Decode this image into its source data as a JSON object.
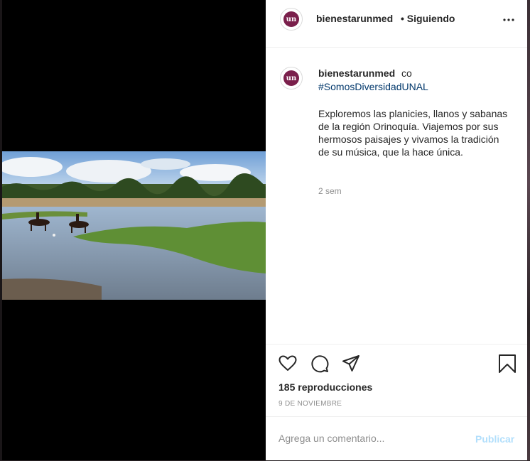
{
  "header": {
    "username": "bienestarunmed",
    "separator": "•",
    "following": "Siguiendo",
    "avatar_text": "un"
  },
  "caption": {
    "username": "bienestarunmed",
    "coauthor_prefix": "co",
    "hashtag": "#SomosDiversidadUNAL",
    "body": "Exploremos las planicies, llanos y sabanas de la región Orinoquía. Viajemos por sus hermosos paisajes y vivamos la tradición de su música, que la hace única.",
    "time_ago": "2 sem"
  },
  "actions": {
    "views": "185 reproducciones",
    "date": "9 DE NOVIEMBRE"
  },
  "comment": {
    "placeholder": "Agrega un comentario...",
    "publish_label": "Publicar"
  },
  "icons": {
    "more": "more-options-icon",
    "like": "heart-icon",
    "comment": "comment-bubble-icon",
    "share": "paper-plane-icon",
    "save": "bookmark-icon"
  },
  "colors": {
    "hashtag": "#00376b",
    "brand_avatar": "#7a1f4b",
    "publish_disabled": "#b2dffc",
    "muted_text": "#8e8e8e"
  }
}
